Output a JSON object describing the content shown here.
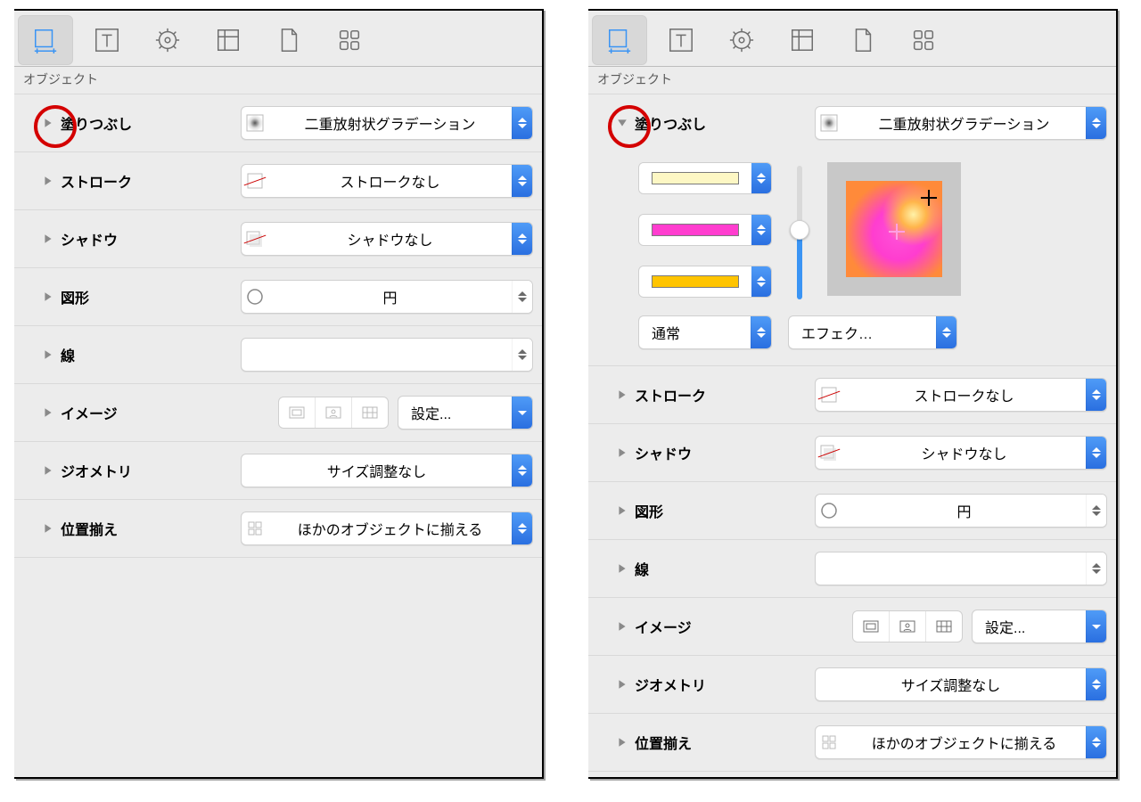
{
  "sub_header": "オブジェクト",
  "rows": {
    "fill": {
      "label": "塗りつぶし",
      "value": "二重放射状グラデーション"
    },
    "stroke": {
      "label": "ストローク",
      "value": "ストロークなし"
    },
    "shadow": {
      "label": "シャドウ",
      "value": "シャドウなし"
    },
    "shape": {
      "label": "図形",
      "value": "円"
    },
    "line": {
      "label": "線",
      "value": ""
    },
    "image": {
      "label": "イメージ",
      "settings": "設定..."
    },
    "geometry": {
      "label": "ジオメトリ",
      "value": "サイズ調整なし"
    },
    "alignment": {
      "label": "位置揃え",
      "value": "ほかのオブジェクトに揃える"
    }
  },
  "fill_expanded": {
    "colors": [
      "#fdf7c4",
      "#ff3dcf",
      "#ffc400"
    ],
    "blend_mode": "通常",
    "effect": "エフェク…"
  }
}
